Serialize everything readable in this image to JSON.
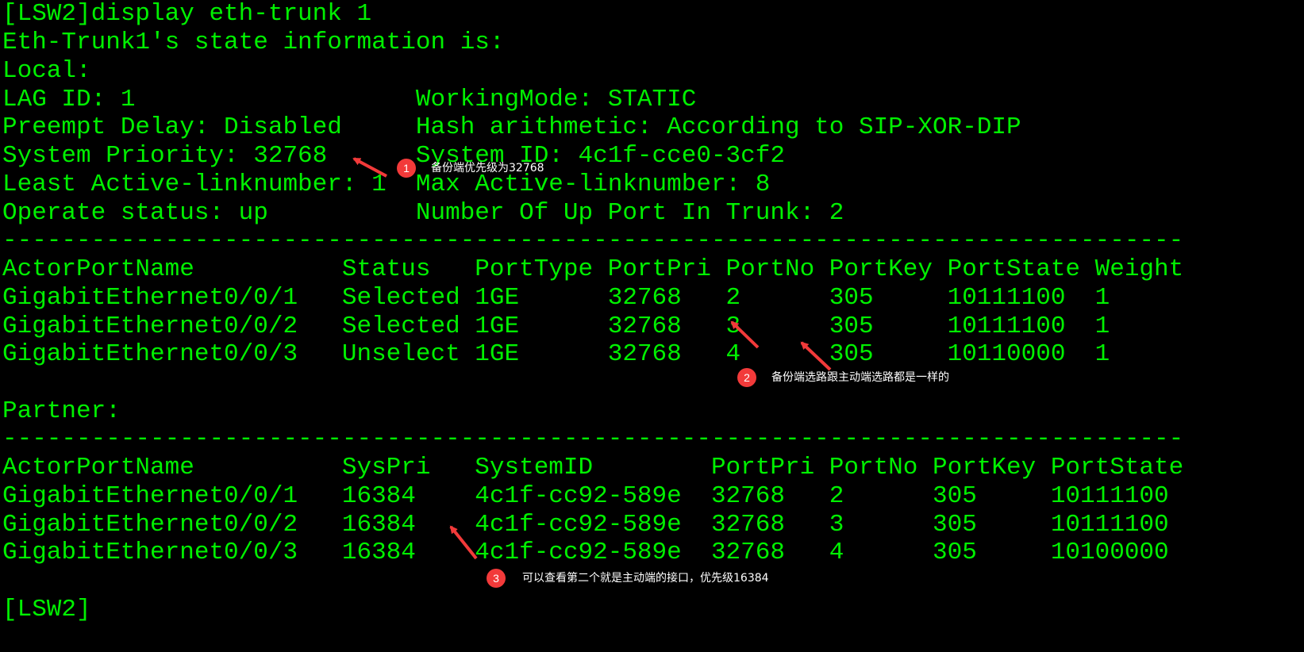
{
  "terminal": {
    "lines": [
      "[LSW2]display eth-trunk 1",
      "Eth-Trunk1's state information is:",
      "Local:",
      "LAG ID: 1                   WorkingMode: STATIC",
      "Preempt Delay: Disabled     Hash arithmetic: According to SIP-XOR-DIP",
      "System Priority: 32768      System ID: 4c1f-cce0-3cf2",
      "Least Active-linknumber: 1  Max Active-linknumber: 8",
      "Operate status: up          Number Of Up Port In Trunk: 2",
      "--------------------------------------------------------------------------------",
      "ActorPortName          Status   PortType PortPri PortNo PortKey PortState Weight",
      "GigabitEthernet0/0/1   Selected 1GE      32768   2      305     10111100  1",
      "GigabitEthernet0/0/2   Selected 1GE      32768   3      305     10111100  1",
      "GigabitEthernet0/0/3   Unselect 1GE      32768   4      305     10110000  1",
      "",
      "Partner:",
      "--------------------------------------------------------------------------------",
      "ActorPortName          SysPri   SystemID        PortPri PortNo PortKey PortState",
      "GigabitEthernet0/0/1   16384    4c1f-cc92-589e  32768   2      305     10111100",
      "GigabitEthernet0/0/2   16384    4c1f-cc92-589e  32768   3      305     10111100",
      "GigabitEthernet0/0/3   16384    4c1f-cc92-589e  32768   4      305     10100000",
      "",
      "[LSW2]"
    ]
  },
  "annotations": [
    {
      "number": "1",
      "text": "备份端优先级为32768"
    },
    {
      "number": "2",
      "text": "备份端选路跟主动端选路都是一样的"
    },
    {
      "number": "3",
      "text": "可以查看第二个就是主动端的接口，优先级16384"
    }
  ],
  "colors": {
    "background": "#000000",
    "terminal_text": "#00f000",
    "callout": "#f23a3a",
    "callout_text": "#ffffff"
  }
}
